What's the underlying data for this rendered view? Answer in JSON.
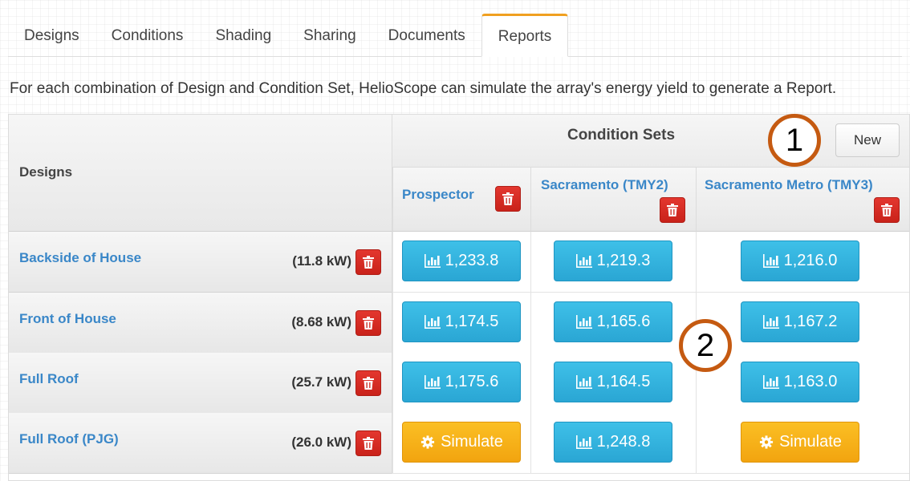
{
  "tabs": [
    "Designs",
    "Conditions",
    "Shading",
    "Sharing",
    "Documents",
    "Reports"
  ],
  "active_tab": "Reports",
  "intro_text": "For each combination of Design and Condition Set, HelioScope can simulate the array's energy yield to generate a Report.",
  "table": {
    "designs_header": "Designs",
    "condition_sets_header": "Condition Sets",
    "new_button": "New",
    "condition_sets": [
      "Prospector",
      "Sacramento (TMY2)",
      "Sacramento Metro (TMY3)"
    ],
    "rows": [
      {
        "name": "Backside of House",
        "kw": "(11.8 kW)",
        "cells": [
          "1,233.8",
          "1,219.3",
          "1,216.0"
        ]
      },
      {
        "name": "Front of House",
        "kw": "(8.68 kW)",
        "cells": [
          "1,174.5",
          "1,165.6",
          "1,167.2"
        ]
      },
      {
        "name": "Full Roof",
        "kw": "(25.7 kW)",
        "cells": [
          "1,175.6",
          "1,164.5",
          "1,163.0"
        ]
      },
      {
        "name": "Full Roof (PJG)",
        "kw": "(26.0 kW)",
        "cells": [
          "Simulate",
          "1,248.8",
          "Simulate"
        ]
      }
    ]
  },
  "cell_types": [
    [
      "report",
      "report",
      "report"
    ],
    [
      "report",
      "report",
      "report"
    ],
    [
      "report",
      "report",
      "report"
    ],
    [
      "simulate",
      "report",
      "simulate"
    ]
  ],
  "annotations": [
    "1",
    "2"
  ],
  "colors": {
    "link": "#3a87c8",
    "report_button": "#2fb0dd",
    "simulate_button": "#f6ab15",
    "delete_button": "#d62b22",
    "active_tab_accent": "#f0a020",
    "annotation_circle": "#c55a11"
  },
  "icons": {
    "report": "bar-chart-icon",
    "simulate": "gear-icon",
    "delete": "trash-icon"
  }
}
